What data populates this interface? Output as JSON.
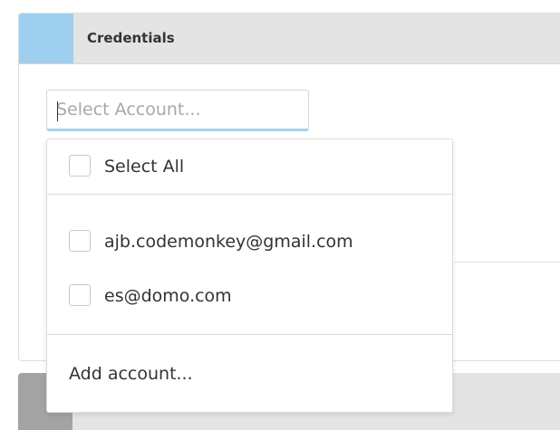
{
  "credentials_card": {
    "title": "Credentials"
  },
  "account_select": {
    "placeholder": "Select Account...",
    "value": ""
  },
  "dropdown": {
    "select_all_label": "Select All",
    "accounts": [
      {
        "label": "ajb.codemonkey@gmail.com",
        "checked": false
      },
      {
        "label": "es@domo.com",
        "checked": false
      }
    ],
    "add_account_label": "Add account..."
  },
  "colors": {
    "header_bg": "#e4e4e4",
    "credentials_accent": "#9fcfee",
    "second_card_accent": "#a3a3a3",
    "input_focus_border": "#a6d3ef"
  }
}
